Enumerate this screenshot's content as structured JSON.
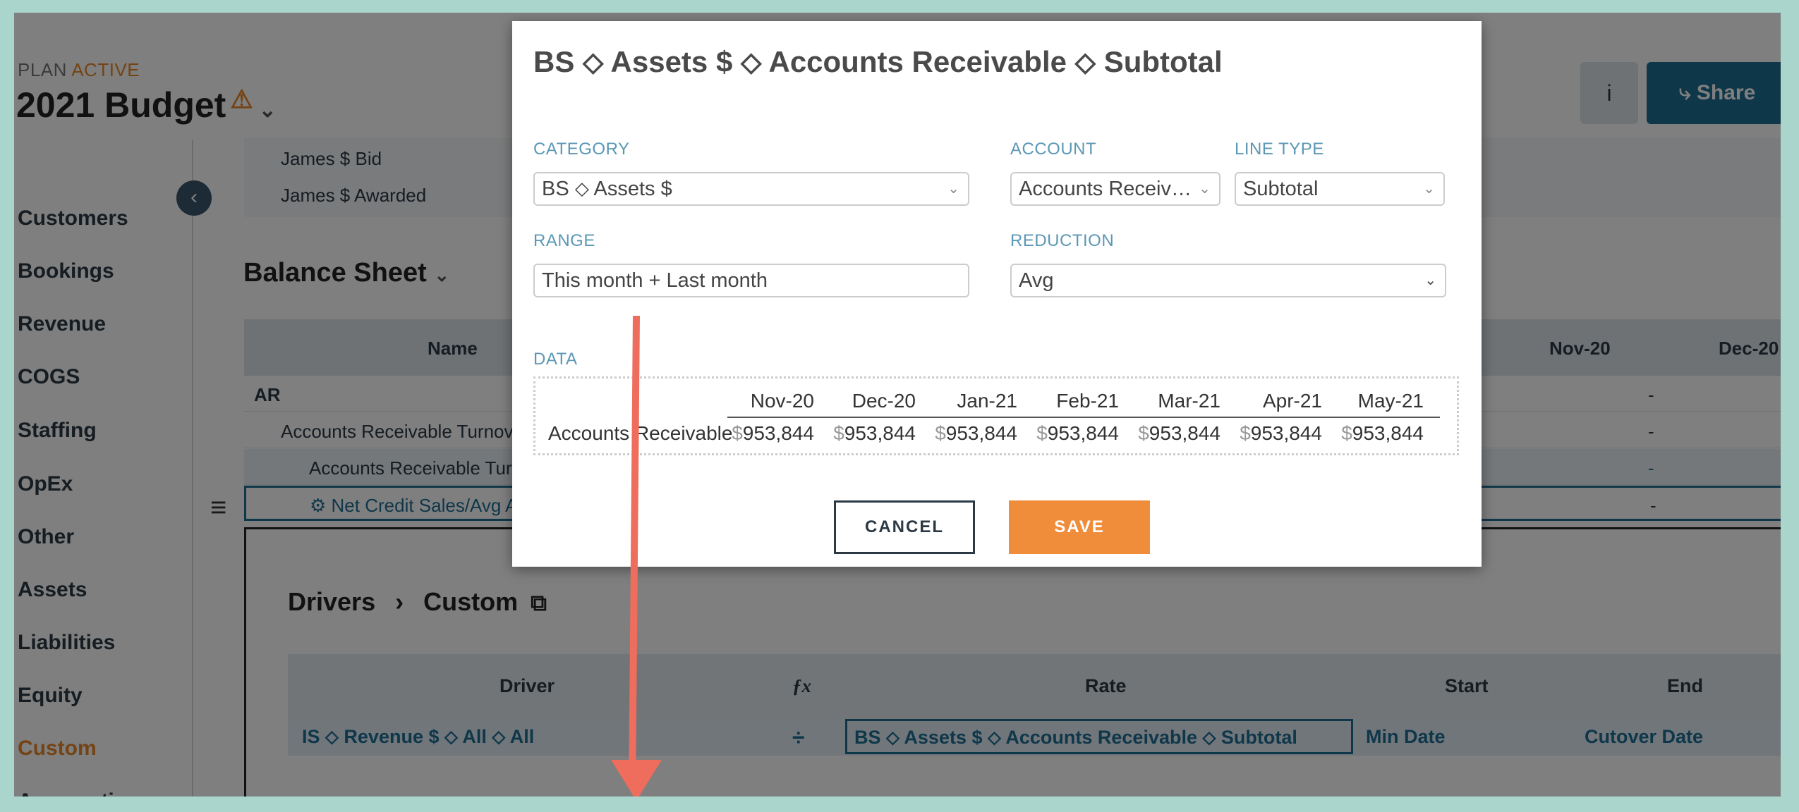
{
  "plan": {
    "label": "PLAN",
    "status": "ACTIVE",
    "title": "2021 Budget",
    "warn_icon": "⚠",
    "chevron": "⌄"
  },
  "sidebar": {
    "items": [
      "Customers",
      "Bookings",
      "Revenue",
      "COGS",
      "Staffing",
      "OpEx",
      "Other",
      "Assets",
      "Liabilities",
      "Equity",
      "Custom",
      "Assumptions"
    ],
    "collapse_icon": "‹"
  },
  "topbar": {
    "info_icon": "i",
    "share_label": "Share",
    "share_icon": "⤷"
  },
  "top_rows": [
    "James $ Bid",
    "James $ Awarded"
  ],
  "balance_sheet": {
    "title": "Balance Sheet",
    "header_name": "Name",
    "header_nov": "Nov-20",
    "header_dec": "Dec-20",
    "rows": [
      "AR",
      "Accounts Receivable Turnove",
      "Accounts Receivable Turn",
      "⚙ Net Credit Sales/Avg AR"
    ],
    "dash": "-"
  },
  "drivers": {
    "breadcrumb_1": "Drivers",
    "separator": "›",
    "breadcrumb_2": "Custom",
    "headers": {
      "driver": "Driver",
      "fx": "ƒx",
      "rate": "Rate",
      "start": "Start",
      "end": "End"
    },
    "row": {
      "driver": "IS ⬦ Revenue $ ⬦ All ⬦ All",
      "op": "÷",
      "rate": "BS ⬦ Assets $ ⬦ Accounts Receivable ⬦ Subtotal",
      "start": "Min Date",
      "end": "Cutover Date"
    }
  },
  "modal": {
    "title": "BS ⬦ Assets $ ⬦ Accounts Receivable ⬦ Subtotal",
    "category_label": "CATEGORY",
    "category_value": "BS ⬦ Assets $",
    "account_label": "ACCOUNT",
    "account_value": "Accounts Receiv…",
    "linetype_label": "LINE TYPE",
    "linetype_value": "Subtotal",
    "range_label": "RANGE",
    "range_value": "This month + Last month",
    "reduction_label": "REDUCTION",
    "reduction_value": "Avg",
    "data_label": "DATA",
    "data_row_label": "Accounts Receivable",
    "months": [
      "Nov-20",
      "Dec-20",
      "Jan-21",
      "Feb-21",
      "Mar-21",
      "Apr-21",
      "May-21"
    ],
    "values": [
      "953,844",
      "953,844",
      "953,844",
      "953,844",
      "953,844",
      "953,844",
      "953,844"
    ],
    "currency": "$",
    "cancel_label": "CANCEL",
    "save_label": "SAVE"
  }
}
